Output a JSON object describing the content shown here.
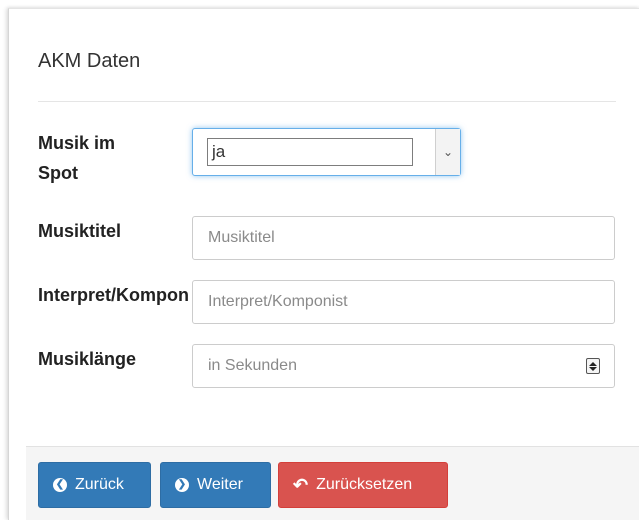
{
  "form": {
    "title": "AKM Daten",
    "music_in_spot": {
      "label": "Musik im Spot",
      "value": "ja"
    },
    "music_title": {
      "label": "Musiktitel",
      "placeholder": "Musiktitel"
    },
    "artist_composer": {
      "label": "Interpret/Komponist",
      "placeholder": "Interpret/Komponist"
    },
    "music_length": {
      "label": "Musiklänge",
      "placeholder": "in Sekunden"
    }
  },
  "footer": {
    "back_label": "Zurück",
    "next_label": "Weiter",
    "reset_label": "Zurücksetzen"
  },
  "icons": {
    "back": "arrow-circle-left-icon",
    "next": "arrow-circle-right-icon",
    "reset": "undo-icon",
    "dropdown": "chevron-down-icon",
    "spinner": "number-spinner-icon"
  },
  "colors": {
    "primary": "#337ab7",
    "danger": "#d9534f",
    "focus": "#66afe9"
  }
}
